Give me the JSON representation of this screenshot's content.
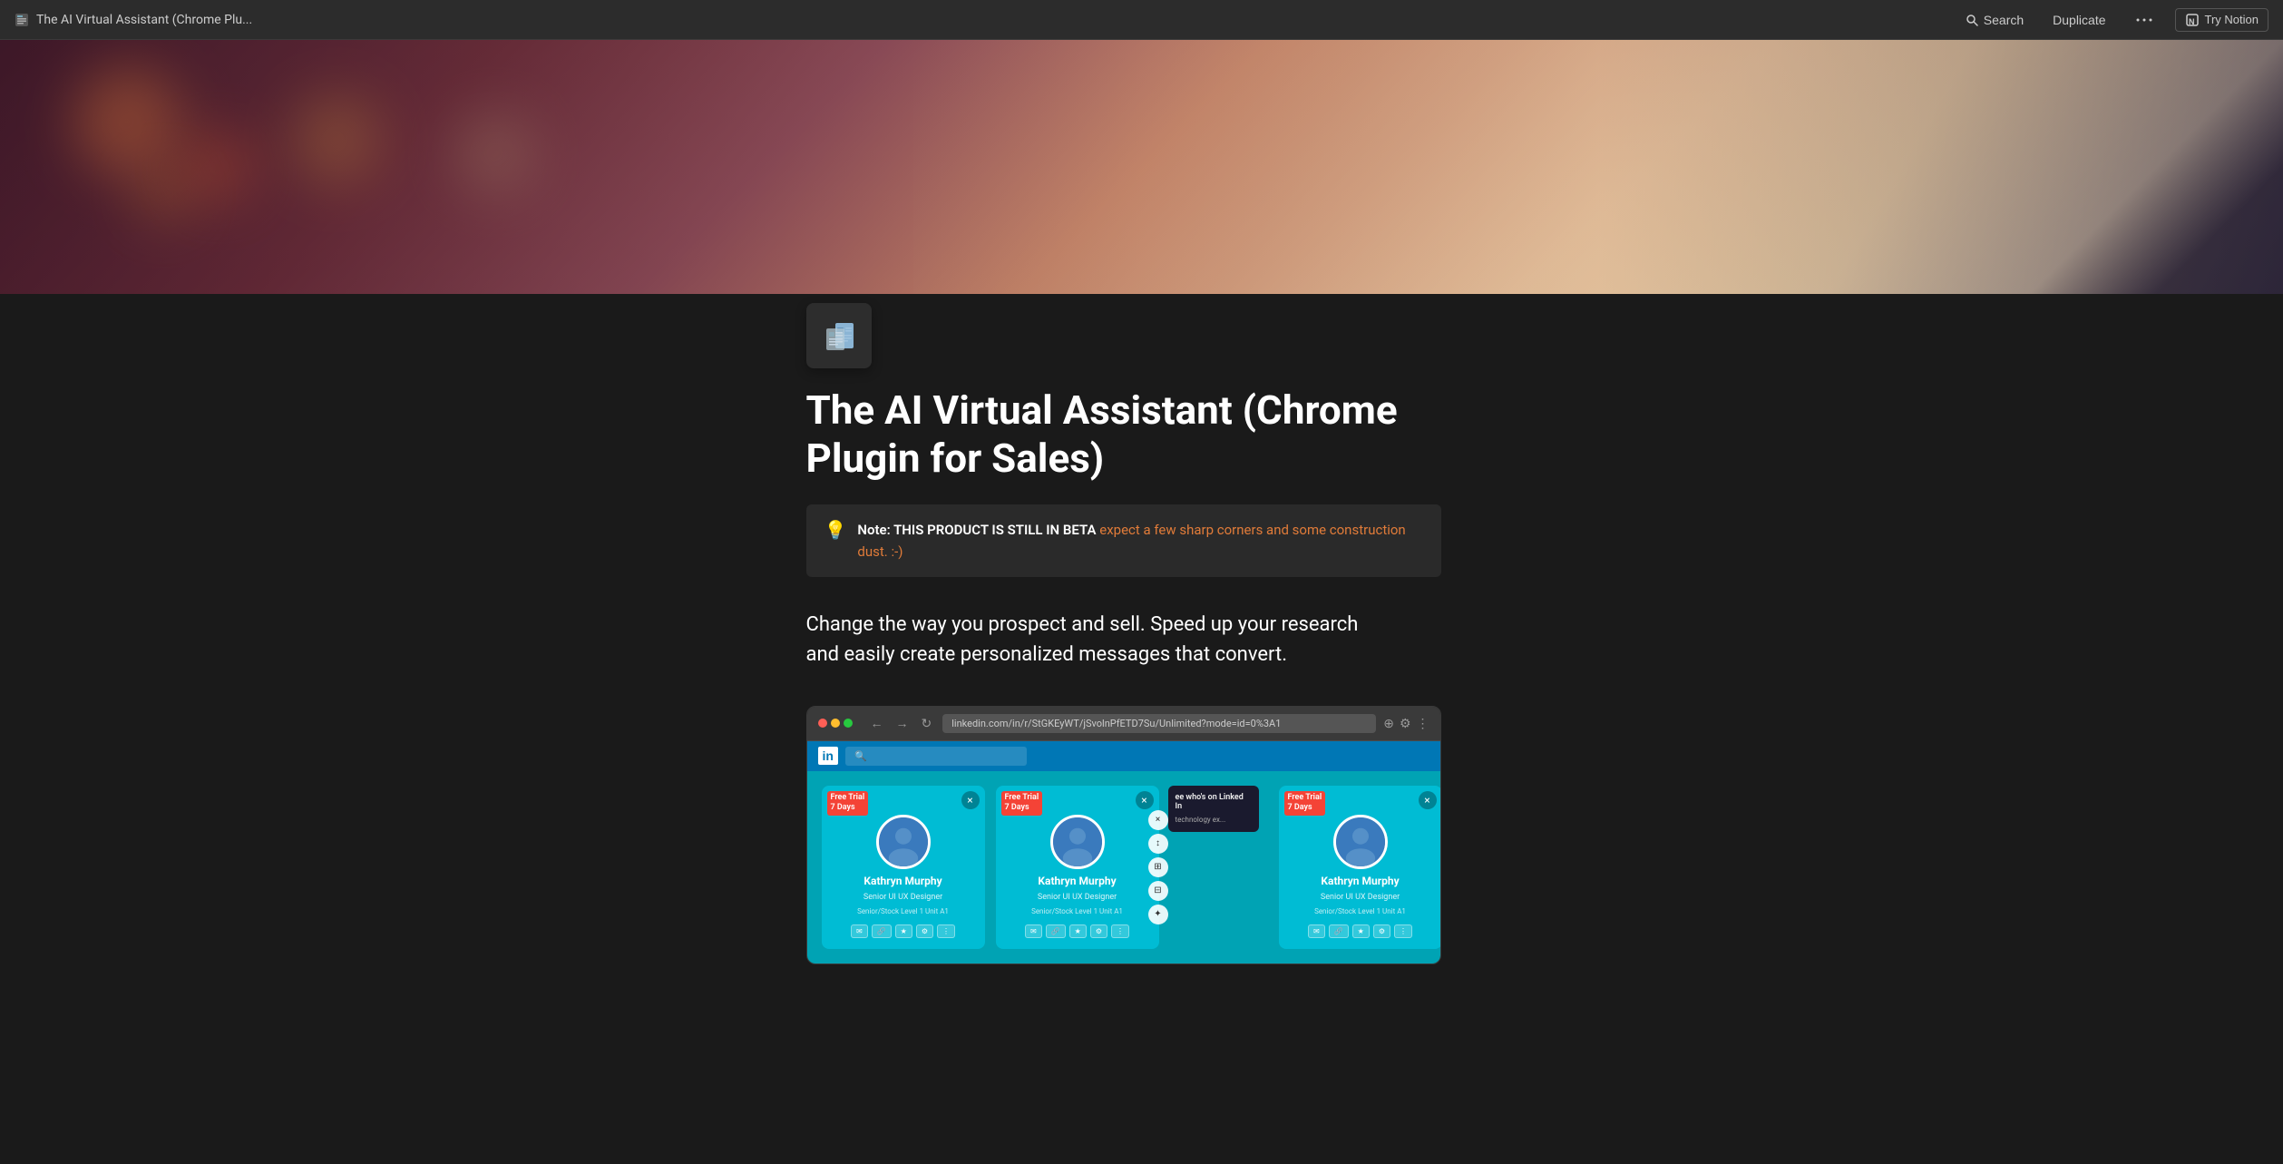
{
  "topbar": {
    "title": "The AI Virtual Assistant (Chrome Plu...",
    "search_label": "Search",
    "duplicate_label": "Duplicate",
    "more_label": "...",
    "try_notion_label": "Try Notion"
  },
  "hero": {
    "alt": "Hero banner with bokeh lights and hand"
  },
  "page": {
    "icon_alt": "Document/newspaper icon",
    "title": "The AI Virtual Assistant (Chrome Plugin for Sales)",
    "beta_note_icon": "💡",
    "beta_note_prefix": "Note: THIS PRODUCT IS STILL IN BETA",
    "beta_note_highlight": " expect a few sharp corners and some construction dust. :-)",
    "description_line1": "Change the way you prospect and sell. Speed up your research",
    "description_line2": "and easily create personalized messages that convert."
  },
  "browser": {
    "url": "linkedin.com/in/r/StGKEyWT/jSvolnPfETD7Su/Unlimited?mode=id=0%3A1",
    "close_label": "×",
    "min_label": "−",
    "max_label": "+",
    "nav_back": "←",
    "nav_forward": "→",
    "nav_refresh": "↻"
  },
  "profile_cards": [
    {
      "name": "Kathryn Murphy",
      "role": "Senior UI UX Designer",
      "company": "Senior/Stock Level 1 Unit A1",
      "badge": "Free Trial\n7 Days"
    },
    {
      "name": "Kathryn Murphy",
      "role": "Senior UI UX Designer",
      "company": "Senior/Stock Level 1 Unit A1",
      "badge": "Free Trial\n7 Days"
    },
    {
      "name": "Kathryn Murphy",
      "role": "Senior UI UX Designer",
      "company": "Senior/Stock Level 1 Unit A1",
      "badge": "Free Trial\n7 Days"
    }
  ],
  "linkedin_text": "ee who's on Linked In",
  "colors": {
    "accent_orange": "#e07b39",
    "bg_dark": "#1a1a1a",
    "topbar_bg": "#2c2c2c",
    "card_bg": "#2a2a2a",
    "linkedin_blue": "#0077b5",
    "teal": "#00bcd4"
  }
}
